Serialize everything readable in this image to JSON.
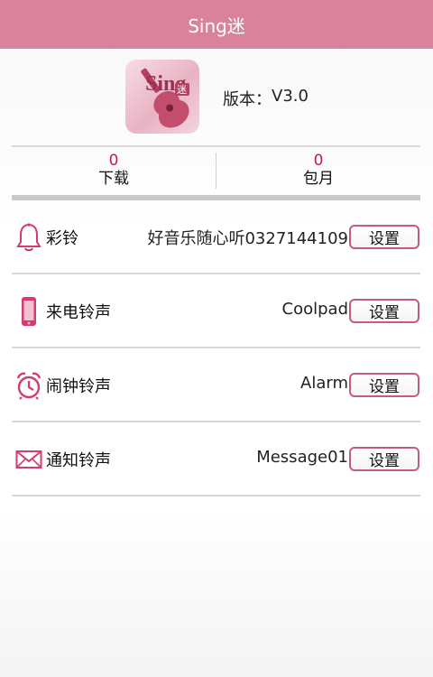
{
  "header": {
    "title": "Sing迷"
  },
  "app": {
    "logo_text": "Sing",
    "logo_badge": "迷",
    "version_label": "版本：",
    "version_value": "V3.0"
  },
  "stats": [
    {
      "value": "0",
      "label": "下载"
    },
    {
      "value": "0",
      "label": "包月"
    }
  ],
  "settings": [
    {
      "title": "彩铃",
      "value": "好音乐随心听0327144109",
      "button": "设置",
      "icon": "bell-icon"
    },
    {
      "title": "来电铃声",
      "value": "Coolpad",
      "button": "设置",
      "icon": "phone-icon"
    },
    {
      "title": "闹钟铃声",
      "value": "Alarm",
      "button": "设置",
      "icon": "alarm-clock-icon"
    },
    {
      "title": "通知铃声",
      "value": "Message01",
      "button": "设置",
      "icon": "envelope-icon"
    }
  ],
  "colors": {
    "header_bg": "#d9829b",
    "accent": "#c2185b",
    "button_border": "#c55b84"
  }
}
